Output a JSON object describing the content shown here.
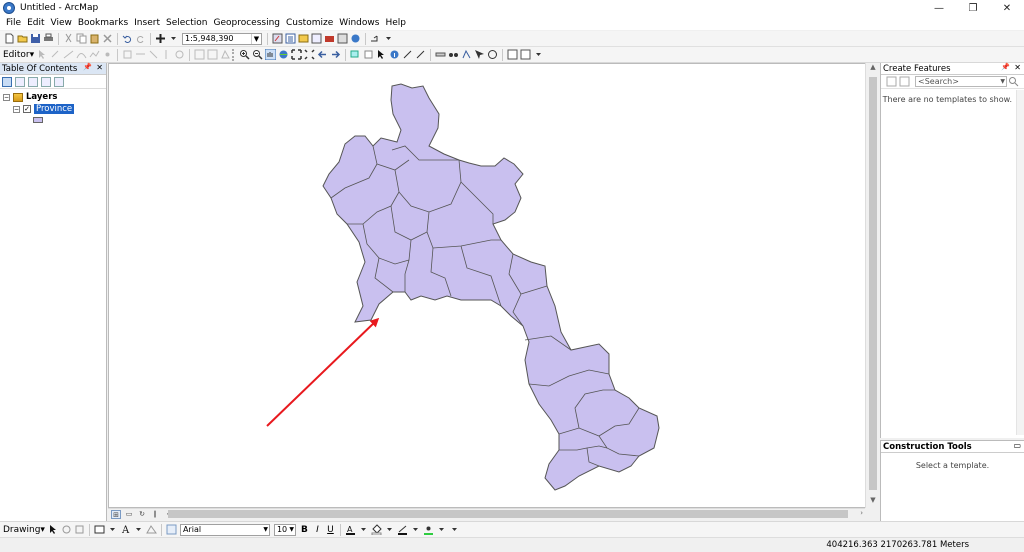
{
  "window": {
    "title": "Untitled - ArcMap",
    "minimize": "—",
    "restore": "❐",
    "close": "✕"
  },
  "menu": [
    "File",
    "Edit",
    "View",
    "Bookmarks",
    "Insert",
    "Selection",
    "Geoprocessing",
    "Customize",
    "Windows",
    "Help"
  ],
  "standard_toolbar": {
    "scale": "1:5,948,390"
  },
  "editor_toolbar": {
    "label": "Editor▾"
  },
  "toc": {
    "title": "Table Of Contents",
    "root_label": "Layers",
    "layer_name": "Province",
    "layer_checked": true,
    "fill_color": "#c9c0ef"
  },
  "map": {
    "feature_fill": "#c9c0ef",
    "feature_stroke": "#555555",
    "arrow_color": "#e8191e"
  },
  "create_features": {
    "title": "Create Features",
    "search_placeholder": "<Search>",
    "empty_message": "There are no templates to show."
  },
  "construction_tools": {
    "title": "Construction Tools",
    "message": "Select a template."
  },
  "drawing_toolbar": {
    "label": "Drawing▾",
    "font": "Arial",
    "font_size": "10",
    "bold": "B",
    "italic": "I",
    "underline": "U"
  },
  "status": {
    "coordinates": "404216.363  2170263.781 Meters"
  }
}
